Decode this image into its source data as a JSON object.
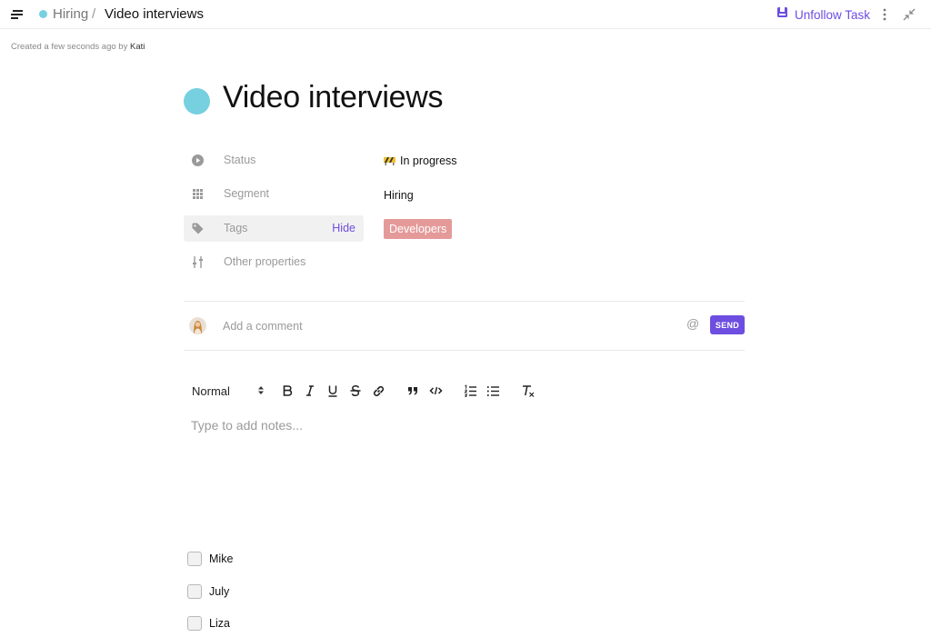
{
  "colors": {
    "accent": "#6d4ee0",
    "segment_dot": "#76d0e0",
    "tag_bg": "#e59a9a",
    "icon_gray": "#9a9a9a"
  },
  "topbar": {
    "menu_icon": "menu-icon",
    "breadcrumb_parent": "Hiring",
    "breadcrumb_separator": "/",
    "breadcrumb_current": "Video interviews",
    "unfollow_label": "Unfollow Task",
    "unfollow_icon": "bookmark-icon",
    "more_icon": "more-vertical-icon",
    "collapse_icon": "collapse-icon"
  },
  "meta": {
    "created_text": "Created a few seconds ago by",
    "author": "Kati"
  },
  "task": {
    "title": "Video interviews"
  },
  "properties": [
    {
      "label": "Status",
      "icon": "status-icon",
      "value": "In progress",
      "value_icon": "construction-icon"
    },
    {
      "label": "Segment",
      "icon": "grid-icon",
      "value": "Hiring"
    },
    {
      "label": "Tags",
      "icon": "tag-icon",
      "action": "Hide",
      "tag": "Developers"
    },
    {
      "label": "Other properties",
      "icon": "sliders-icon"
    }
  ],
  "comment": {
    "placeholder": "Add a comment",
    "at_symbol": "@",
    "send_label": "SEND"
  },
  "toolbar": {
    "format_select": "Normal",
    "buttons": [
      "bold-icon",
      "italic-icon",
      "underline-icon",
      "strikethrough-icon",
      "link-icon",
      "quote-icon",
      "code-icon",
      "ordered-list-icon",
      "bullet-list-icon",
      "clear-format-icon"
    ]
  },
  "notes": {
    "placeholder": "Type to add notes..."
  },
  "checklist": [
    {
      "label": "Mike",
      "checked": false
    },
    {
      "label": "July",
      "checked": false
    },
    {
      "label": "Liza",
      "checked": false
    }
  ]
}
